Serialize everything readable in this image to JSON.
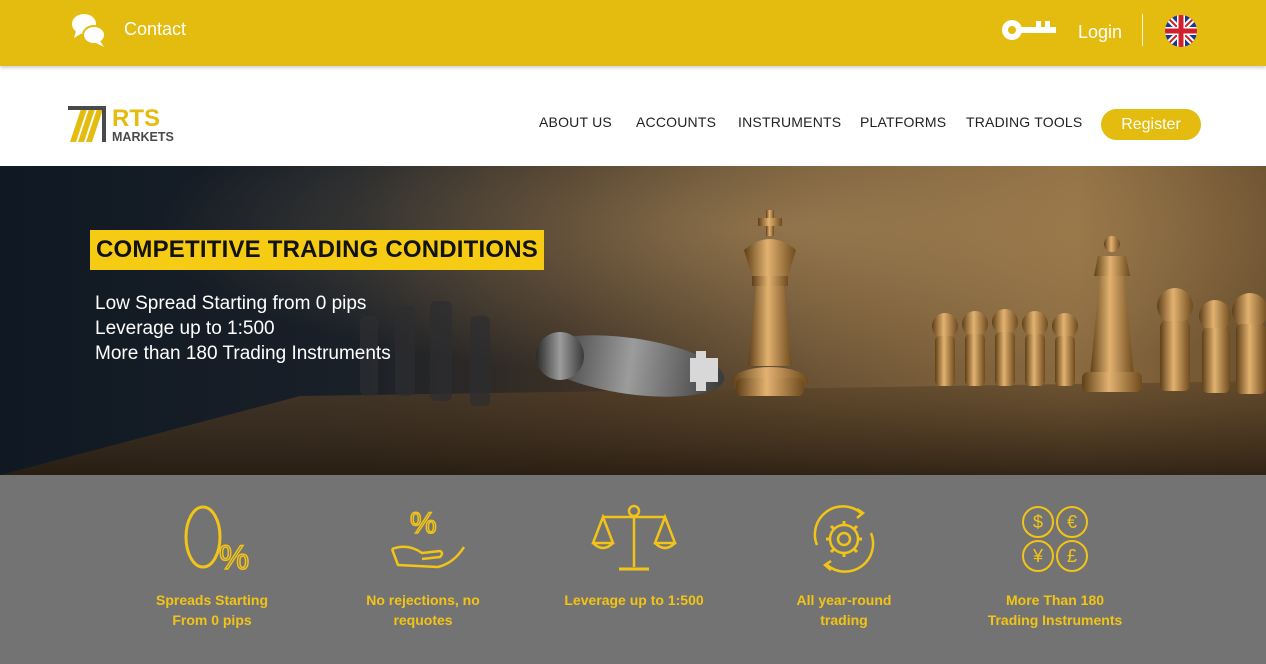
{
  "topbar": {
    "contact_label": "Contact",
    "login_label": "Login",
    "chat_icon": "chat-bubbles-icon",
    "key_icon": "key-icon",
    "flag_icon": "uk-flag-icon"
  },
  "logo": {
    "brand": "RTS",
    "sub": "MARKETS"
  },
  "nav": {
    "items": [
      {
        "label": "ABOUT US"
      },
      {
        "label": "ACCOUNTS"
      },
      {
        "label": "INSTRUMENTS"
      },
      {
        "label": "PLATFORMS"
      },
      {
        "label": "TRADING TOOLS"
      }
    ],
    "register_label": "Register"
  },
  "hero": {
    "title": "COMPETITIVE TRADING CONDITIONS",
    "lines": [
      "Low Spread Starting from 0 pips",
      "Leverage up to 1:500",
      "More than 180 Trading Instruments"
    ]
  },
  "features": {
    "items": [
      {
        "icon": "zero-percent-icon",
        "line1": "Spreads Starting",
        "line2": "From 0 pips"
      },
      {
        "icon": "percent-hand-icon",
        "line1": "No rejections, no",
        "line2": "requotes"
      },
      {
        "icon": "scales-icon",
        "line1": "Leverage up to 1:500",
        "line2": ""
      },
      {
        "icon": "gear-cycle-icon",
        "line1": "All year-round",
        "line2": "trading"
      },
      {
        "icon": "currencies-icon",
        "line1": "More Than 180",
        "line2": "Trading Instruments"
      }
    ]
  },
  "colors": {
    "brand_yellow": "#e3bc0f",
    "hero_title_bg": "#f5cb14",
    "feature_text": "#f2c417",
    "features_bg": "#737373",
    "hero_bg": "#111a26"
  }
}
